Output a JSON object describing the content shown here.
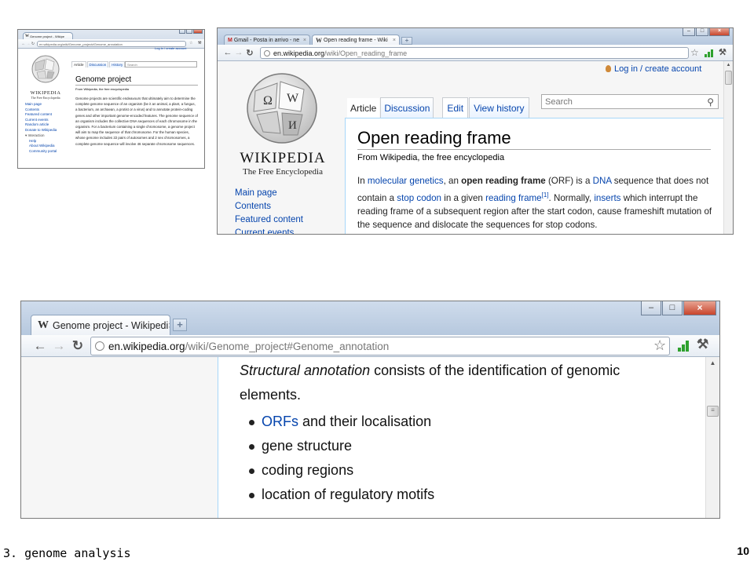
{
  "small_window": {
    "tab_title": "Genome project - Wikipe",
    "url": "en.wikipedia.org/wiki/Genome_project#Genome_annotation",
    "login": "Log in / create account",
    "tabs": [
      "Article",
      "Discussion",
      "History"
    ],
    "search_placeholder": "Search",
    "logo_title": "WIKIPEDIA",
    "logo_subtitle": "The Free Encyclopedia",
    "heading": "Genome project",
    "from": "From Wikipedia, the free encyclopedia",
    "sidebar": [
      "Main page",
      "Contents",
      "Featured content",
      "Current events",
      "Random article",
      "Donate to Wikipedia"
    ],
    "interaction_heading": "Interaction",
    "interaction": [
      "Help",
      "About Wikipedia",
      "Community portal"
    ],
    "paragraph": "Genome projects are scientific endeavours that ultimately aim to determine the complete genome sequence of an organism (be it an animal, a plant, a fungus, a bacterium, an archaean, a protist or a virus) and to annotate protein-coding genes and other important genome-encoded features. The genome sequence of an organism includes the collective DNA sequences of each chromosome in the organism. For a bacterium containing a single chromosome, a genome project will aim to map the sequence of that chromosome. For the human species, whose genome includes 22 pairs of autosomes and 2 sex chromosomes, a complete genome sequence will involve 46 separate chromosome sequences."
  },
  "orf_window": {
    "tab1": "Gmail - Posta in arrivo - ne",
    "tab2": "Open reading frame - Wiki",
    "url_host": "en.wikipedia.org",
    "url_path": "/wiki/Open_reading_frame",
    "login": "Log in / create account",
    "tabs": [
      "Article",
      "Discussion",
      "Edit",
      "View history"
    ],
    "search_placeholder": "Search",
    "logo_title": "WIKIPEDIA",
    "logo_subtitle": "The Free Encyclopedia",
    "heading": "Open reading frame",
    "from": "From Wikipedia, the free encyclopedia",
    "sidebar": [
      "Main page",
      "Contents",
      "Featured content",
      "Current events"
    ],
    "p_in": "In ",
    "p_link1": "molecular genetics",
    "p_t1": ", an ",
    "p_bold": "open reading frame",
    "p_t2": " (ORF) is a ",
    "p_link2": "DNA",
    "p_t3": " sequence that does not contain a ",
    "p_link3": "stop codon",
    "p_t4": " in a given ",
    "p_link4": "reading frame",
    "p_ref": "[1]",
    "p_t5": ". Normally, ",
    "p_link5": "inserts",
    "p_t6": " which interrupt the reading frame of a subsequent region after the start codon, cause frameshift mutation of the sequence and dislocate the sequences for stop codons."
  },
  "annotation_window": {
    "tab_title": "Genome project - Wikipedi",
    "url_host": "en.wikipedia.org",
    "url_path": "/wiki/Genome_project#Genome_annotation",
    "line1_italic": "Structural annotation",
    "line1_rest": " consists of the identification of genomic",
    "line2": "elements.",
    "bullet1_link": "ORFs",
    "bullet1_rest": " and their localisation",
    "bullet2": "gene structure",
    "bullet3": "coding regions",
    "bullet4": "location of regulatory motifs"
  },
  "footer": {
    "left": "3. genome analysis",
    "page_number": "10"
  }
}
